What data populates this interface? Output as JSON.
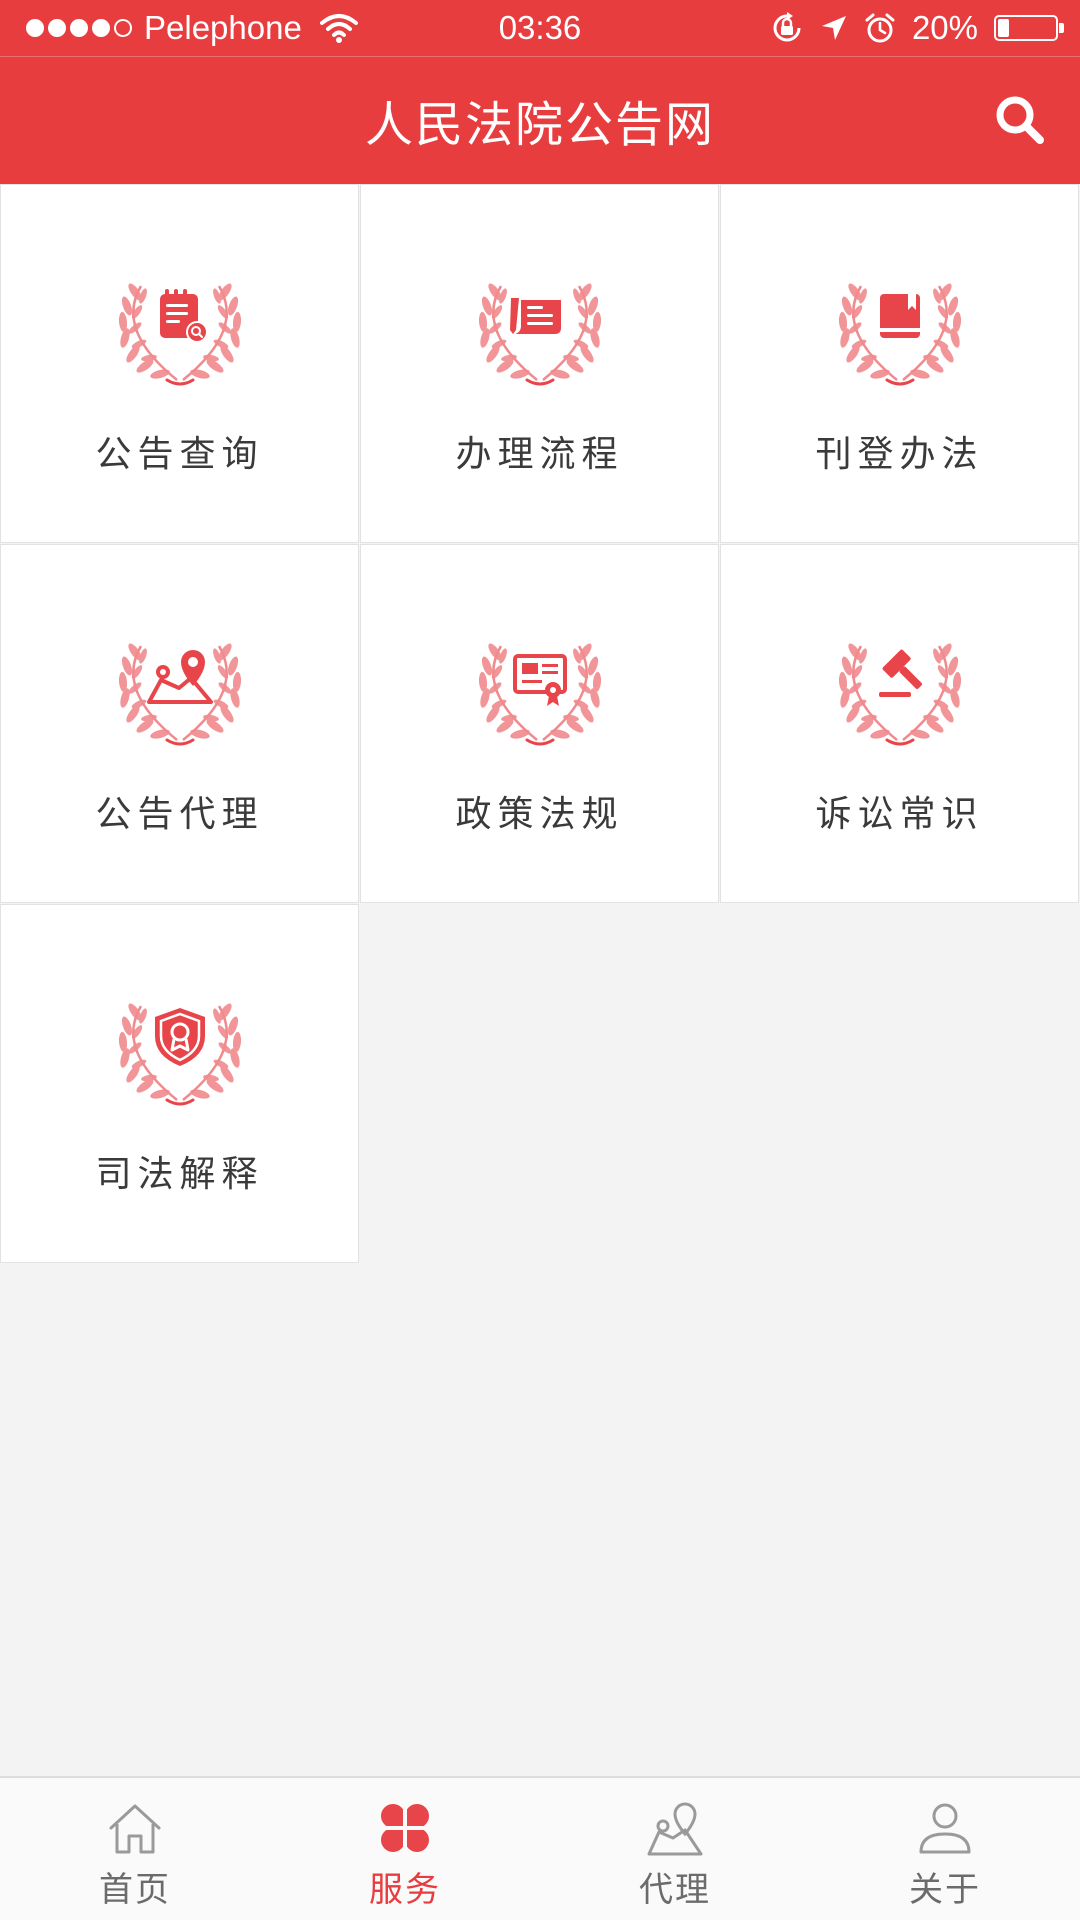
{
  "status_bar": {
    "carrier": "Pelephone",
    "time": "03:36",
    "battery_text": "20%",
    "battery_level": 0.2,
    "signal_bars_filled": 4,
    "signal_bars_total": 5
  },
  "header": {
    "title": "人民法院公告网"
  },
  "grid": {
    "items": [
      {
        "label": "公告查询",
        "icon": "notice-search-icon"
      },
      {
        "label": "办理流程",
        "icon": "process-icon"
      },
      {
        "label": "刊登办法",
        "icon": "book-icon"
      },
      {
        "label": "公告代理",
        "icon": "map-location-icon"
      },
      {
        "label": "政策法规",
        "icon": "certificate-icon"
      },
      {
        "label": "诉讼常识",
        "icon": "gavel-icon"
      },
      {
        "label": "司法解释",
        "icon": "shield-badge-icon"
      }
    ]
  },
  "tab_bar": {
    "active_index": 1,
    "items": [
      {
        "label": "首页",
        "icon": "home-icon"
      },
      {
        "label": "服务",
        "icon": "clover-icon"
      },
      {
        "label": "代理",
        "icon": "map-pin-icon"
      },
      {
        "label": "关于",
        "icon": "user-icon"
      }
    ]
  },
  "colors": {
    "brand_red": "#e83d3f",
    "icon_red": "#e8454a",
    "wreath_red": "#f08a8d",
    "tab_gray": "#9a9a9a",
    "background": "#f3f3f3"
  }
}
